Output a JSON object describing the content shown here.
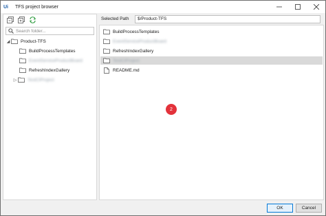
{
  "window": {
    "app_icon_text": "Ui",
    "title": "TFS project browser"
  },
  "left_pane": {
    "search_placeholder": "Search folder...",
    "tree": [
      {
        "label": "Product-TFS",
        "expanded": true,
        "blurred": false
      },
      {
        "label": "BuildProcessTemplates",
        "blurred": false
      },
      {
        "label": "EventServiceProductBoard",
        "blurred": true
      },
      {
        "label": "RefreshIndexGallery",
        "blurred": false
      },
      {
        "label": "TestCIProject",
        "blurred": true
      }
    ]
  },
  "right_pane": {
    "selected_path_label": "Selected Path",
    "selected_path_value": "$/Product-TFS",
    "items": [
      {
        "label": "BuildProcessTemplates",
        "type": "folder",
        "blurred": false,
        "selected": false
      },
      {
        "label": "EventServiceProductBoard",
        "type": "folder",
        "blurred": true,
        "selected": false
      },
      {
        "label": "RefreshIndexGallery",
        "type": "folder",
        "blurred": false,
        "selected": false
      },
      {
        "label": "TestCIProject",
        "type": "folder",
        "blurred": true,
        "selected": true
      },
      {
        "label": "README.md",
        "type": "file",
        "blurred": false,
        "selected": false
      }
    ]
  },
  "badge": "2",
  "footer": {
    "ok_label": "OK",
    "cancel_label": "Cancel"
  },
  "colors": {
    "accent": "#1c5ea8",
    "badge": "#e3323b",
    "folder": "#4a4a4a",
    "refresh_icon": "#2e9c3f"
  },
  "icons": [
    "collapse-all-icon",
    "expand-all-icon",
    "refresh-icon",
    "search-icon",
    "folder-icon",
    "file-icon",
    "minimize-icon",
    "maximize-icon",
    "close-icon"
  ]
}
